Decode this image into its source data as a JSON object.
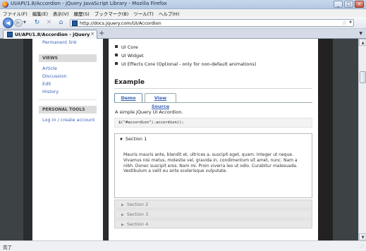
{
  "window": {
    "title": "UI/API/1.8/Accordion - jQuery JavaScript Library - Mozilla Firefox",
    "minimize": "_",
    "maximize": "□",
    "close": "×"
  },
  "menu": [
    "ファイル(F)",
    "編集(E)",
    "表示(V)",
    "履歴(S)",
    "ブックマーク(B)",
    "ツール(T)",
    "ヘルプ(H)"
  ],
  "nav": {
    "back": "◀",
    "forward": "▶",
    "dropdown": "▼",
    "reload": "↻",
    "stop": "✕",
    "home": "⌂",
    "url": "http://docs.jquery.com/UI/Accordion",
    "star": "☆",
    "url_drop": "▼"
  },
  "tabs": {
    "active_label": "UI/API/1.8/Accordion - jQuery Ja...",
    "close": "×",
    "new_tab": "+",
    "list": "▼"
  },
  "sidebar": {
    "permanent_link": "Permanent link",
    "views_heading": "VIEWS",
    "views": [
      "Article",
      "Discussion",
      "Edit",
      "History"
    ],
    "tools_heading": "PERSONAL TOOLS",
    "login": "Log in / create account"
  },
  "content": {
    "dependencies": [
      "UI Core",
      "UI Widget",
      "UI Effects Core (Optional - only for non-default animations)"
    ],
    "example_heading": "Example",
    "tab_demo": "Demo",
    "tab_source": "View Source",
    "intro": "A simple jQuery UI Accordion.",
    "code": "$(\"#accordion\").accordion();",
    "accordion": {
      "open_section": "Section 1",
      "open_marker": "▼",
      "closed_marker": "▶",
      "body": "Mauris mauris ante, blandit et, ultrices a, suscipit eget, quam. Integer ut neque. Vivamus nisi metus, molestie vel, gravida in, condimentum sit amet, nunc. Nam a nibh. Donec suscipit eros. Nam mi. Proin viverra leo ut odio. Curabitur malesuada. Vestibulum a velit eu ante scelerisque vulputate.",
      "closed_sections": [
        "Section 2",
        "Section 3",
        "Section 4"
      ]
    }
  },
  "scrollbar": {
    "up": "▲",
    "down": "▼"
  },
  "status": {
    "text": "完了",
    "grip": "⋰"
  }
}
